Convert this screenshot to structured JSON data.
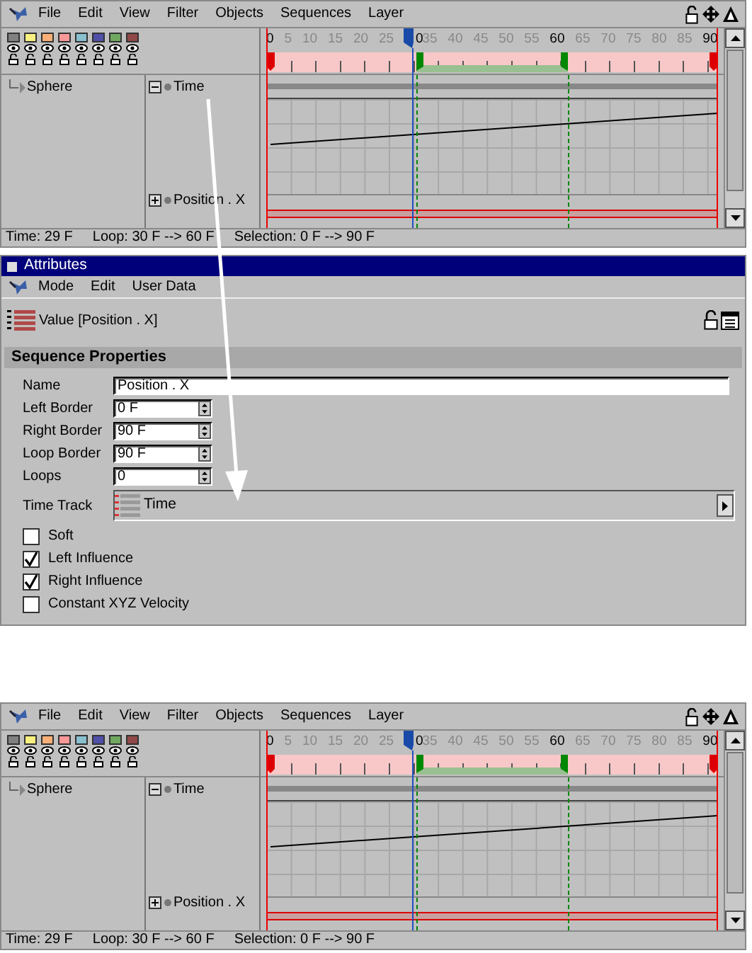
{
  "timelines": [
    {
      "menu": [
        "File",
        "Edit",
        "View",
        "Filter",
        "Objects",
        "Sequences",
        "Layer"
      ],
      "layers": [
        {
          "color": "#808080"
        },
        {
          "color": "#f8f080"
        },
        {
          "color": "#f8b078"
        },
        {
          "color": "#f89898"
        },
        {
          "color": "#88c0d0"
        },
        {
          "color": "#5050a8"
        },
        {
          "color": "#70a860"
        },
        {
          "color": "#904848"
        }
      ],
      "ruler": [
        {
          "label": "0",
          "emphasized": true
        },
        {
          "label": "5",
          "emphasized": false
        },
        {
          "label": "10",
          "emphasized": false
        },
        {
          "label": "15",
          "emphasized": false
        },
        {
          "label": "20",
          "emphasized": false
        },
        {
          "label": "25",
          "emphasized": false
        },
        {
          "label": "0",
          "emphasized": true
        },
        {
          "label": "35",
          "emphasized": false
        },
        {
          "label": "40",
          "emphasized": false
        },
        {
          "label": "45",
          "emphasized": false
        },
        {
          "label": "50",
          "emphasized": false
        },
        {
          "label": "55",
          "emphasized": false
        },
        {
          "label": "60",
          "emphasized": true
        },
        {
          "label": "65",
          "emphasized": false
        },
        {
          "label": "70",
          "emphasized": false
        },
        {
          "label": "75",
          "emphasized": false
        },
        {
          "label": "80",
          "emphasized": false
        },
        {
          "label": "85",
          "emphasized": false
        },
        {
          "label": "90",
          "emphasized": true
        }
      ],
      "playhead": {
        "level": 0.322
      },
      "loop_start": {
        "level": 0.333
      },
      "loop_end": {
        "level": 0.667
      },
      "objects": [
        {
          "label": "Sphere"
        }
      ],
      "tracks": [
        {
          "label": "Time",
          "expanded": true
        },
        {
          "label": "Position . X",
          "expanded": false
        }
      ],
      "status": [
        "Time: 29 F",
        "Loop: 30 F --> 60 F",
        "Selection: 0 F --> 90 F"
      ]
    },
    {
      "menu": [
        "File",
        "Edit",
        "View",
        "Filter",
        "Objects",
        "Sequences",
        "Layer"
      ],
      "layers": [
        {
          "color": "#808080"
        },
        {
          "color": "#f8f080"
        },
        {
          "color": "#f8b078"
        },
        {
          "color": "#f89898"
        },
        {
          "color": "#88c0d0"
        },
        {
          "color": "#5050a8"
        },
        {
          "color": "#70a860"
        },
        {
          "color": "#904848"
        }
      ],
      "ruler": [
        {
          "label": "0",
          "emphasized": true
        },
        {
          "label": "5",
          "emphasized": false
        },
        {
          "label": "10",
          "emphasized": false
        },
        {
          "label": "15",
          "emphasized": false
        },
        {
          "label": "20",
          "emphasized": false
        },
        {
          "label": "25",
          "emphasized": false
        },
        {
          "label": "0",
          "emphasized": true
        },
        {
          "label": "35",
          "emphasized": false
        },
        {
          "label": "40",
          "emphasized": false
        },
        {
          "label": "45",
          "emphasized": false
        },
        {
          "label": "50",
          "emphasized": false
        },
        {
          "label": "55",
          "emphasized": false
        },
        {
          "label": "60",
          "emphasized": true
        },
        {
          "label": "65",
          "emphasized": false
        },
        {
          "label": "70",
          "emphasized": false
        },
        {
          "label": "75",
          "emphasized": false
        },
        {
          "label": "80",
          "emphasized": false
        },
        {
          "label": "85",
          "emphasized": false
        },
        {
          "label": "90",
          "emphasized": true
        }
      ],
      "playhead": {
        "level": 0.322
      },
      "loop_start": {
        "level": 0.333
      },
      "loop_end": {
        "level": 0.667
      },
      "objects": [
        {
          "label": "Sphere"
        }
      ],
      "tracks": [
        {
          "label": "Time",
          "expanded": true
        },
        {
          "label": "Position . X",
          "expanded": false
        }
      ],
      "status": [
        "Time: 29 F",
        "Loop: 30 F --> 60 F",
        "Selection: 0 F --> 90 F"
      ]
    }
  ],
  "attributes": {
    "title": "Attributes",
    "menu": [
      "Mode",
      "Edit",
      "User Data"
    ],
    "header": "Value [Position . X]",
    "section": "Sequence Properties",
    "fields": [
      {
        "label": "Name",
        "value": "Position . X",
        "kind": "text"
      },
      {
        "label": "Left Border",
        "value": "0 F",
        "kind": "spinner"
      },
      {
        "label": "Right Border",
        "value": "90 F",
        "kind": "spinner"
      },
      {
        "label": "Loop Border",
        "value": "90 F",
        "kind": "spinner"
      },
      {
        "label": "Loops",
        "value": "0",
        "kind": "spinner"
      },
      {
        "label": "Time Track",
        "value": "Time",
        "kind": "link"
      }
    ],
    "checkboxes": [
      {
        "label": "Soft",
        "checked": false
      },
      {
        "label": "Left Influence",
        "checked": true
      },
      {
        "label": "Right Influence",
        "checked": true
      },
      {
        "label": "Constant XYZ Velocity",
        "checked": false
      }
    ]
  }
}
